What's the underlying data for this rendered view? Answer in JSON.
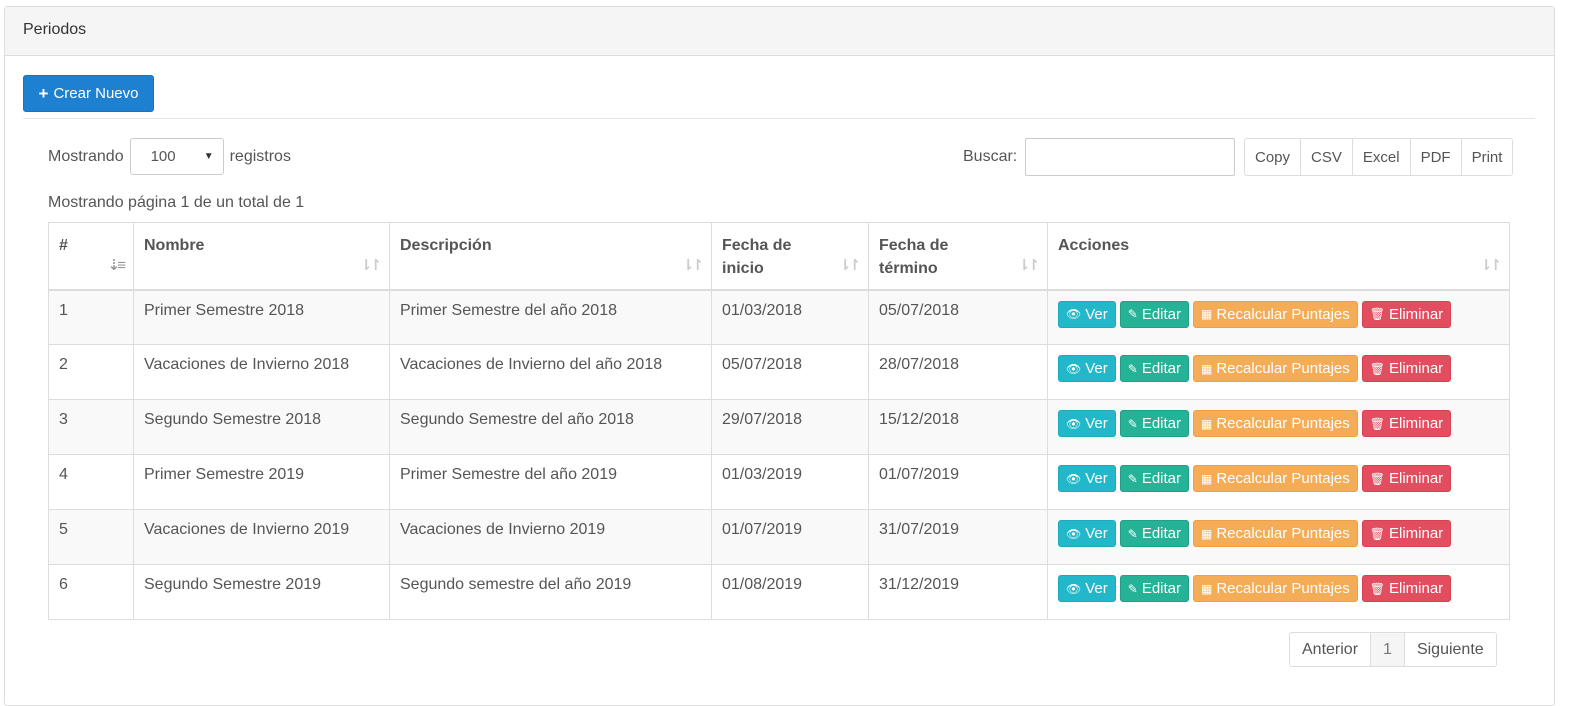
{
  "panel": {
    "title": "Periodos"
  },
  "toolbar": {
    "create_label": "Crear Nuevo"
  },
  "length": {
    "prefix": "Mostrando",
    "value": "100",
    "suffix": "registros"
  },
  "search": {
    "label": "Buscar:",
    "value": ""
  },
  "export_buttons": [
    "Copy",
    "CSV",
    "Excel",
    "PDF",
    "Print"
  ],
  "info": "Mostrando página 1 de un total de 1",
  "table": {
    "columns": [
      "#",
      "Nombre",
      "Descripción",
      "Fecha de inicio",
      "Fecha de término",
      "Acciones"
    ],
    "rows": [
      [
        "1",
        "Primer Semestre 2018",
        "Primer Semestre del año 2018",
        "01/03/2018",
        "05/07/2018"
      ],
      [
        "2",
        "Vacaciones de Invierno 2018",
        "Vacaciones de Invierno del año 2018",
        "05/07/2018",
        "28/07/2018"
      ],
      [
        "3",
        "Segundo Semestre 2018",
        "Segundo Semestre del año 2018",
        "29/07/2018",
        "15/12/2018"
      ],
      [
        "4",
        "Primer Semestre 2019",
        "Primer Semestre del año 2019",
        "01/03/2019",
        "01/07/2019"
      ],
      [
        "5",
        "Vacaciones de Invierno 2019",
        "Vacaciones de Invierno 2019",
        "01/07/2019",
        "31/07/2019"
      ],
      [
        "6",
        "Segundo Semestre 2019",
        "Segundo semestre del año 2019",
        "01/08/2019",
        "31/12/2019"
      ]
    ]
  },
  "actions": {
    "view": "Ver",
    "edit": "Editar",
    "recalc": "Recalcular Puntajes",
    "delete": "Eliminar"
  },
  "pagination": {
    "prev": "Anterior",
    "current": "1",
    "next": "Siguiente"
  },
  "colors": {
    "primary": "#1e80d0",
    "info": "#22b8c9",
    "success": "#26b296",
    "warning": "#f5ac56",
    "danger": "#e24e5f"
  },
  "icons": {
    "create": "plus-icon",
    "view": "eye-icon",
    "edit": "edit-icon",
    "recalc": "calculator-icon",
    "delete": "trash-icon",
    "sort": "sort-icon"
  }
}
